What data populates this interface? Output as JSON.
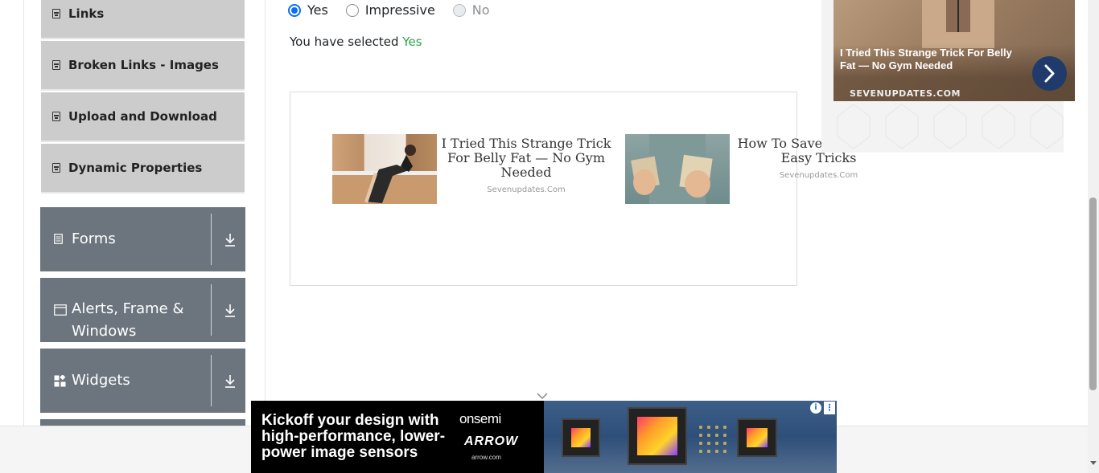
{
  "sidebar": {
    "items": [
      {
        "label": "Links"
      },
      {
        "label": "Broken Links - Images"
      },
      {
        "label": "Upload and Download"
      },
      {
        "label": "Dynamic Properties"
      }
    ],
    "groups": [
      {
        "label": "Forms",
        "icon": "document-icon"
      },
      {
        "label": "Alerts, Frame & Windows",
        "icon": "window-icon"
      },
      {
        "label": "Widgets",
        "icon": "widgets-icon"
      }
    ]
  },
  "radio": {
    "options": [
      {
        "label": "Yes",
        "checked": true,
        "disabled": false
      },
      {
        "label": "Impressive",
        "checked": false,
        "disabled": false
      },
      {
        "label": "No",
        "checked": false,
        "disabled": true
      }
    ],
    "result_prefix": "You have selected",
    "result_value": "Yes"
  },
  "content_ads": [
    {
      "title": "I Tried This Strange Trick For Belly Fat — No Gym Needed",
      "source": "Sevenupdates.Com"
    },
    {
      "title": "How To Save With These Easy Tricks",
      "source": "Sevenupdates.Com"
    }
  ],
  "side_ad": {
    "title": "I Tried This Strange Trick For Belly Fat — No Gym Needed",
    "source": "SEVENUPDATES.COM"
  },
  "banner": {
    "headline": "Kickoff your design with high-performance, lower-power image sensors",
    "brand_primary": "onsemi",
    "brand_secondary": "ARROW",
    "url": "arrow.com",
    "info_glyph": "i",
    "more_glyph": "⋮"
  },
  "colors": {
    "accent": "#0d6efd",
    "success": "#28a745",
    "sidebar_item_bg": "#cccccc",
    "group_bg": "#6c757d"
  }
}
